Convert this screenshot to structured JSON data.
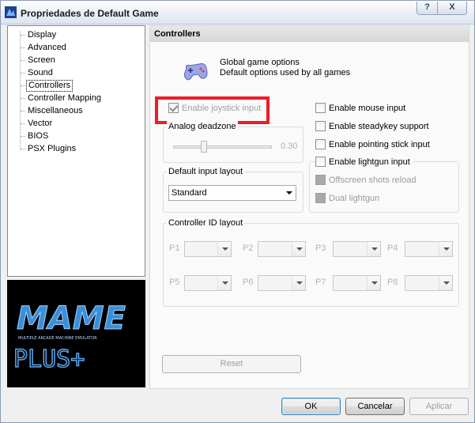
{
  "window": {
    "title": "Propriedades de Default Game"
  },
  "titlebar": {
    "help_label": "?",
    "close_label": "X"
  },
  "tree": {
    "items": [
      "Display",
      "Advanced",
      "Screen",
      "Sound",
      "Controllers",
      "Controller Mapping",
      "Miscellaneous",
      "Vector",
      "BIOS",
      "PSX Plugins"
    ],
    "selected": "Controllers"
  },
  "logo": {
    "brand": "MAME",
    "tagline": "MULTIPLE ARCADE MACHINE EMULATOR",
    "suffix": "PLUS+"
  },
  "panel": {
    "header": "Controllers",
    "info_line1": "Global game options",
    "info_line2": "Default options used by all games"
  },
  "options": {
    "enable_joystick": {
      "label": "Enable joystick input",
      "checked": true,
      "enabled": false
    },
    "enable_mouse": {
      "label": "Enable mouse input",
      "checked": false
    },
    "enable_steadykey": {
      "label": "Enable steadykey support",
      "checked": false
    },
    "enable_pointing_stick": {
      "label": "Enable pointing stick input",
      "checked": false
    },
    "enable_lightgun": {
      "label": "Enable lightgun input",
      "checked": false
    },
    "offscreen_reload": {
      "label": "Offscreen shots reload",
      "enabled": false
    },
    "dual_lightgun": {
      "label": "Dual lightgun",
      "enabled": false
    }
  },
  "analog_deadzone": {
    "label": "Analog deadzone",
    "value": "0.30",
    "fraction": 0.3
  },
  "default_input_layout": {
    "label": "Default input layout",
    "selected": "Standard"
  },
  "controller_id_layout": {
    "label": "Controller ID layout",
    "players": [
      "P1",
      "P2",
      "P3",
      "P4",
      "P5",
      "P6",
      "P7",
      "P8"
    ]
  },
  "buttons": {
    "reset": "Reset",
    "ok": "OK",
    "cancel": "Cancelar",
    "apply": "Aplicar"
  },
  "colors": {
    "highlight": "#ee1c25",
    "logo_blue": "#4a9ee0"
  }
}
